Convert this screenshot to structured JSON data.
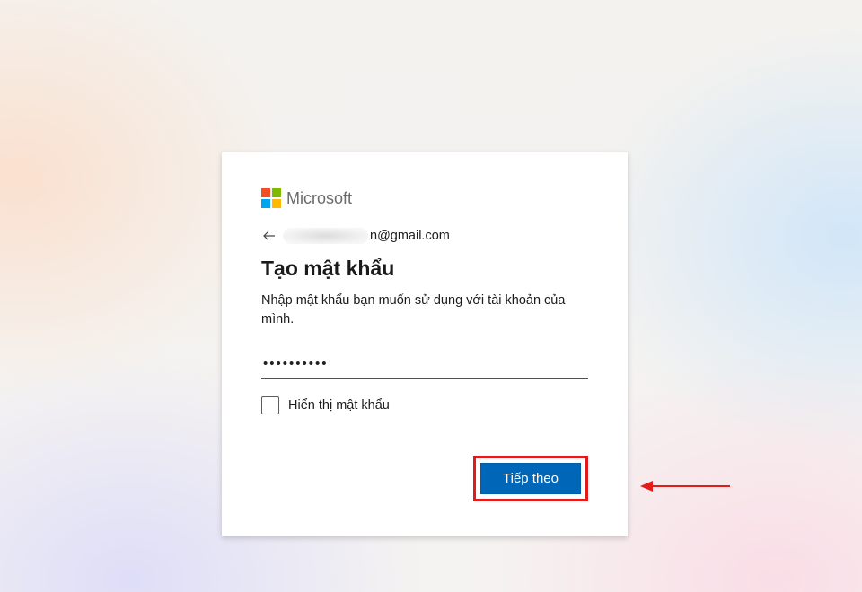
{
  "brand": {
    "name": "Microsoft"
  },
  "identity": {
    "email_visible_suffix": "n@gmail.com"
  },
  "dialog": {
    "title": "Tạo mật khẩu",
    "description": "Nhập mật khẩu bạn muốn sử dụng với tài khoản của mình.",
    "password_value": "••••••••••",
    "show_password_label": "Hiển thị mật khẩu",
    "next_button_label": "Tiếp theo"
  },
  "colors": {
    "primary": "#0067b8",
    "annotation": "#e21b1b"
  }
}
